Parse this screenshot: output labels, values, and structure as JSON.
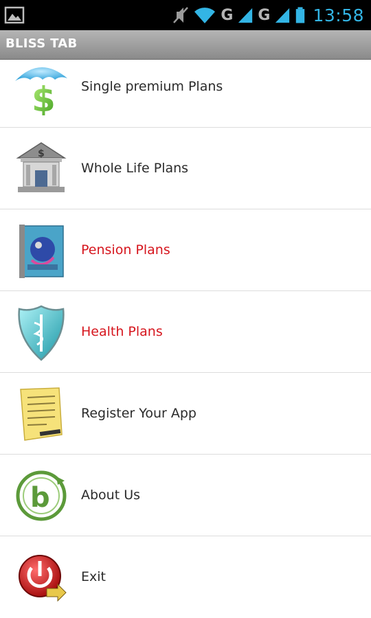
{
  "status_bar": {
    "time": "13:58",
    "network_1": "G",
    "network_2": "G",
    "icons": [
      "gallery-icon",
      "muted-icon",
      "wifi-icon",
      "signal-icon",
      "signal-icon",
      "battery-icon"
    ],
    "accent_color": "#33b5e5"
  },
  "app": {
    "title": "BLISS TAB"
  },
  "menu": {
    "items": [
      {
        "label": "Single premium Plans",
        "icon": "umbrella-dollar-icon",
        "highlighted": false
      },
      {
        "label": "Whole Life Plans",
        "icon": "bank-building-icon",
        "highlighted": false
      },
      {
        "label": "Pension Plans",
        "icon": "pension-book-icon",
        "highlighted": true
      },
      {
        "label": "Health Plans",
        "icon": "medical-shield-icon",
        "highlighted": true
      },
      {
        "label": "Register Your App",
        "icon": "document-icon",
        "highlighted": false
      },
      {
        "label": "About Us",
        "icon": "brand-logo-icon",
        "highlighted": false
      },
      {
        "label": "Exit",
        "icon": "power-exit-icon",
        "highlighted": false
      }
    ],
    "highlight_color": "#d6161e",
    "text_color": "#2b2b2b"
  }
}
